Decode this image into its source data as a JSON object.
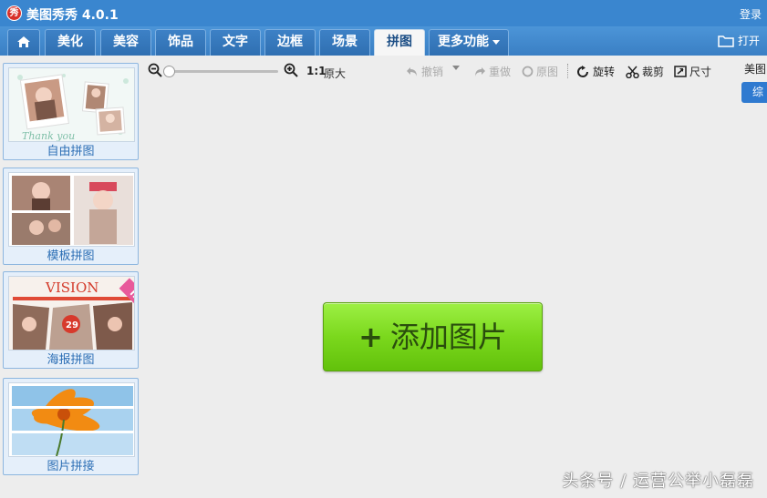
{
  "window": {
    "title": "美图秀秀 4.0.1",
    "logo_char": "秀",
    "login": "登录"
  },
  "tabs": [
    {
      "label": "美化"
    },
    {
      "label": "美容"
    },
    {
      "label": "饰品"
    },
    {
      "label": "文字"
    },
    {
      "label": "边框"
    },
    {
      "label": "场景"
    },
    {
      "label": "拼图",
      "active": true
    },
    {
      "label": "更多功能"
    }
  ],
  "open_button": "打开",
  "sidebar": {
    "cards": [
      {
        "label": "自由拼图",
        "thumb_text": "Thank you"
      },
      {
        "label": "模板拼图"
      },
      {
        "label": "海报拼图",
        "thumb_text": "VISION",
        "badge": "new",
        "poster_number": "29"
      },
      {
        "label": "图片拼接"
      }
    ]
  },
  "toolbar": {
    "ratio": "1:1",
    "original_size": "原大",
    "undo": "撤销",
    "redo": "重做",
    "original_image": "原图",
    "rotate": "旋转",
    "crop": "裁剪",
    "resize": "尺寸"
  },
  "canvas": {
    "add_image": "添加图片",
    "plus": "+"
  },
  "right_panel": {
    "title": "美图",
    "tab": "综"
  },
  "watermark": "头条号 / 运营公举小磊磊",
  "colors": {
    "titlebar": "#3a86cf",
    "accent_green": "#7bd81d",
    "label_blue": "#2d6fb5"
  }
}
